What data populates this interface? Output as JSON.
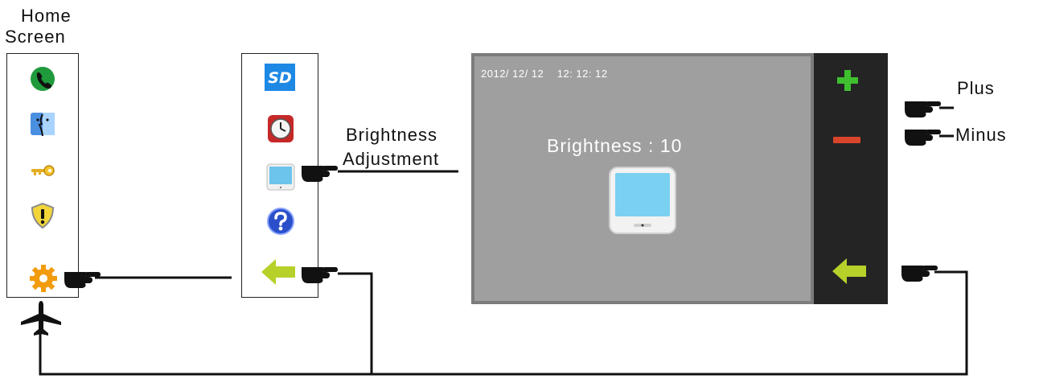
{
  "home_label_line1": "Home",
  "home_label_line2": "Screen",
  "brightness_label_line1": "Brightness",
  "brightness_label_line2": "Adjustment",
  "plus_label": "Plus",
  "minus_label": "Minus",
  "screen": {
    "datetime": "2012/ 12/ 12    12: 12: 12",
    "brightness_text": "Brightness  : 10",
    "sd_text": "SD"
  },
  "home_icons": [
    "phone-icon",
    "finder-icon",
    "key-icon",
    "shield-warning-icon",
    "settings-gear-icon"
  ],
  "settings_icons": [
    "sd-card-icon",
    "clock-icon",
    "monitor-icon",
    "help-icon",
    "back-arrow-icon"
  ],
  "sidebar_icons": [
    "plus-icon",
    "minus-icon",
    "back-arrow-icon"
  ],
  "colors": {
    "screen_bg": "#9f9f9f",
    "sidebar_bg": "#242424",
    "plus": "#3fbf2f",
    "minus": "#d9452b",
    "arrow": "#b7d02a"
  }
}
